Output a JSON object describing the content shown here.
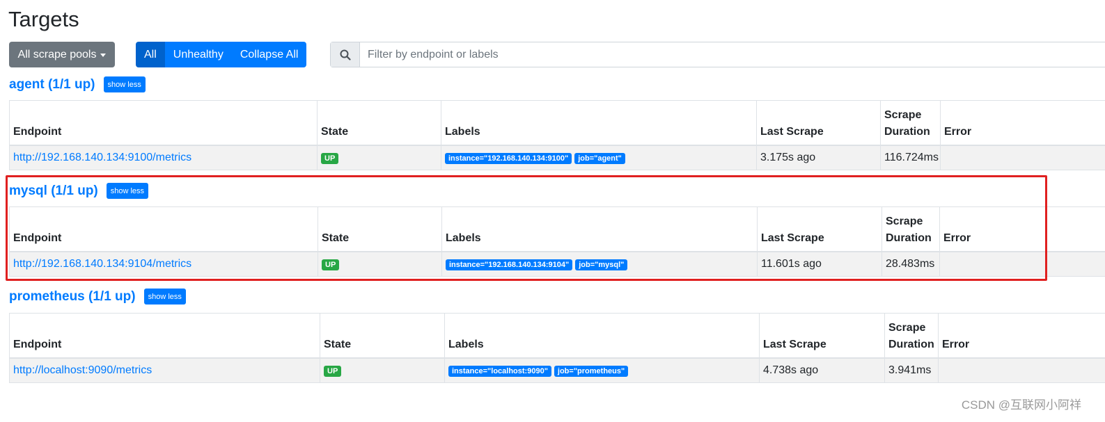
{
  "page": {
    "title": "Targets"
  },
  "toolbar": {
    "pools_label": "All scrape pools",
    "filters": [
      "All",
      "Unhealthy",
      "Collapse All"
    ],
    "search_placeholder": "Filter by endpoint or labels"
  },
  "columns": [
    "Endpoint",
    "State",
    "Labels",
    "Last Scrape",
    "Scrape Duration",
    "Error"
  ],
  "pools": [
    {
      "name": "agent (1/1 up)",
      "toggle": "show less",
      "endpoint": "http://192.168.140.134:9100/metrics",
      "state": "UP",
      "labels": [
        "instance=\"192.168.140.134:9100\"",
        "job=\"agent\""
      ],
      "last_scrape": "3.175s ago",
      "duration": "116.724ms",
      "error": ""
    },
    {
      "name": "mysql (1/1 up)",
      "toggle": "show less",
      "endpoint": "http://192.168.140.134:9104/metrics",
      "state": "UP",
      "labels": [
        "instance=\"192.168.140.134:9104\"",
        "job=\"mysql\""
      ],
      "last_scrape": "11.601s ago",
      "duration": "28.483ms",
      "error": ""
    },
    {
      "name": "prometheus (1/1 up)",
      "toggle": "show less",
      "endpoint": "http://localhost:9090/metrics",
      "state": "UP",
      "labels": [
        "instance=\"localhost:9090\"",
        "job=\"prometheus\""
      ],
      "last_scrape": "4.738s ago",
      "duration": "3.941ms",
      "error": ""
    }
  ],
  "watermark": "CSDN @互联网小阿祥",
  "colors": {
    "primary": "#007bff",
    "success": "#28a745",
    "secondary": "#6c757d",
    "highlight": "#e02020"
  }
}
